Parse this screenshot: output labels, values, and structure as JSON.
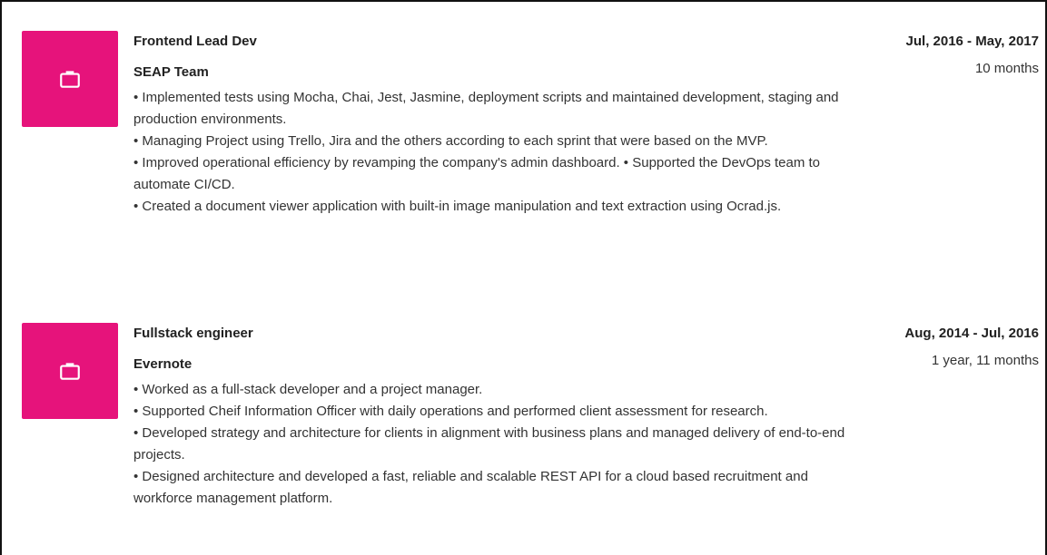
{
  "experience": [
    {
      "icon": "briefcase-icon",
      "title": "Frontend Lead Dev",
      "company": "SEAP Team",
      "date_range": "Jul, 2016 - May, 2017",
      "duration": "10 months",
      "bullets": [
        "• Implemented tests using Mocha, Chai, Jest, Jasmine, deployment scripts and maintained development, staging and production environments.",
        "• Managing Project using Trello, Jira and the others according to each sprint that were based on the MVP.",
        "• Improved operational efficiency by revamping the company's admin dashboard. • Supported the DevOps team to automate CI/CD.",
        "• Created a document viewer application with built-in image manipulation and text extraction using Ocrad.js."
      ]
    },
    {
      "icon": "briefcase-icon",
      "title": "Fullstack engineer",
      "company": "Evernote",
      "date_range": "Aug, 2014 - Jul, 2016",
      "duration": "1 year, 11 months",
      "bullets": [
        "• Worked as a full-stack developer and a project manager.",
        "• Supported Cheif Information Officer with daily operations and performed client assessment for research.",
        "• Developed strategy and architecture for clients in alignment with business plans and managed delivery of end-to-end projects.",
        "• Designed architecture and developed a fast, reliable and scalable REST API for a cloud based recruitment and workforce management platform."
      ]
    }
  ],
  "colors": {
    "badge": "#e6137b",
    "icon": "#ffffff",
    "text": "#212121"
  }
}
